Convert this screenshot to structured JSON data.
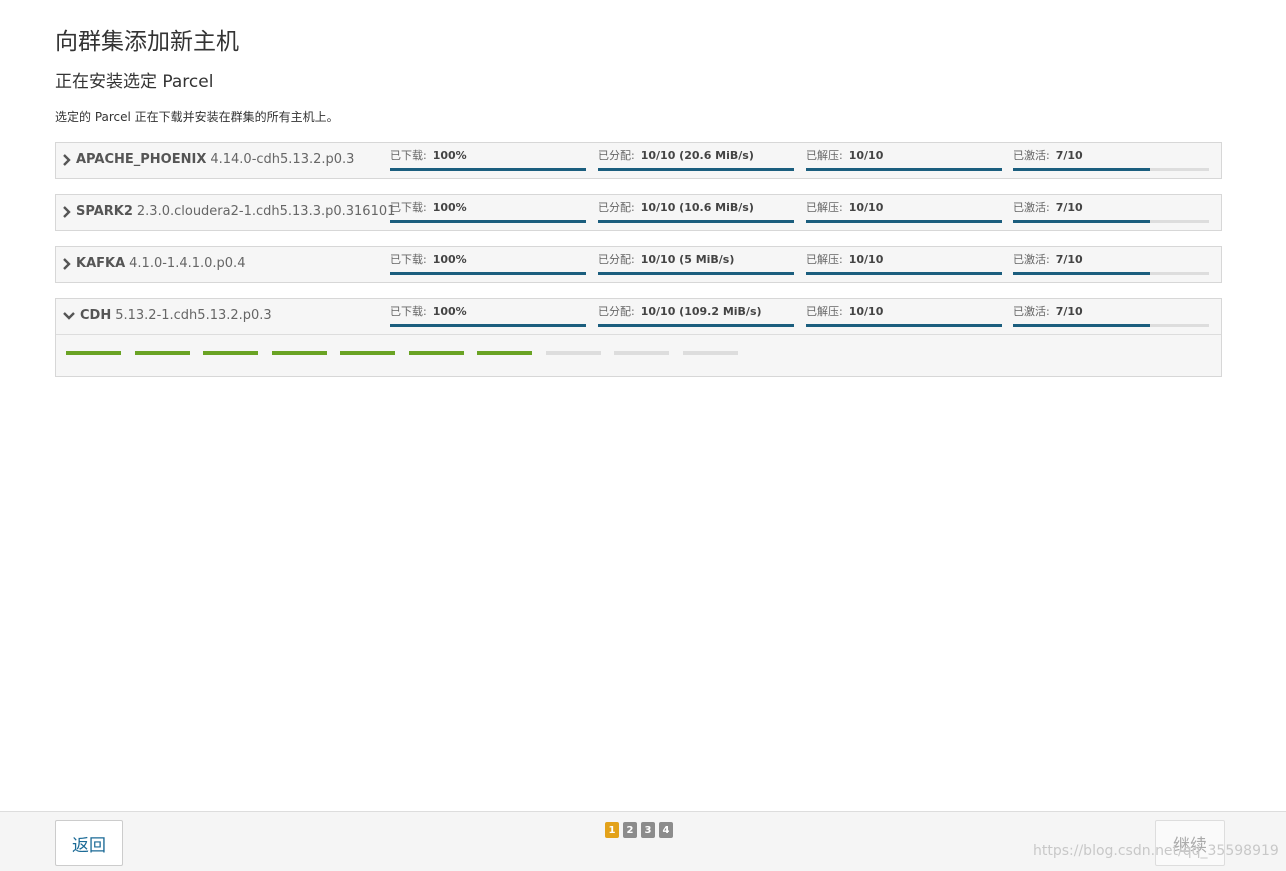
{
  "page_title": "向群集添加新主机",
  "section_title": "正在安装选定 Parcel",
  "description": "选定的 Parcel 正在下载并安装在群集的所有主机上。",
  "parcels": [
    {
      "name": "APACHE_PHOENIX",
      "version": "4.14.0-cdh5.13.2.p0.3",
      "expanded": false,
      "stages": [
        {
          "label": "已下载:",
          "value": "100%",
          "progress": 1.0
        },
        {
          "label": "已分配:",
          "value": "10/10 (20.6 MiB/s)",
          "progress": 1.0
        },
        {
          "label": "已解压:",
          "value": "10/10",
          "progress": 1.0
        },
        {
          "label": "已激活:",
          "value": "7/10",
          "progress": 0.7
        }
      ]
    },
    {
      "name": "SPARK2",
      "version": "2.3.0.cloudera2-1.cdh5.13.3.p0.316101",
      "expanded": false,
      "stages": [
        {
          "label": "已下载:",
          "value": "100%",
          "progress": 1.0
        },
        {
          "label": "已分配:",
          "value": "10/10 (10.6 MiB/s)",
          "progress": 1.0
        },
        {
          "label": "已解压:",
          "value": "10/10",
          "progress": 1.0
        },
        {
          "label": "已激活:",
          "value": "7/10",
          "progress": 0.7
        }
      ]
    },
    {
      "name": "KAFKA",
      "version": "4.1.0-1.4.1.0.p0.4",
      "expanded": false,
      "stages": [
        {
          "label": "已下载:",
          "value": "100%",
          "progress": 1.0
        },
        {
          "label": "已分配:",
          "value": "10/10 (5 MiB/s)",
          "progress": 1.0
        },
        {
          "label": "已解压:",
          "value": "10/10",
          "progress": 1.0
        },
        {
          "label": "已激活:",
          "value": "7/10",
          "progress": 0.7
        }
      ]
    },
    {
      "name": "CDH",
      "version": "5.13.2-1.cdh5.13.2.p0.3",
      "expanded": true,
      "stages": [
        {
          "label": "已下载:",
          "value": "100%",
          "progress": 1.0
        },
        {
          "label": "已分配:",
          "value": "10/10 (109.2 MiB/s)",
          "progress": 1.0
        },
        {
          "label": "已解压:",
          "value": "10/10",
          "progress": 1.0
        },
        {
          "label": "已激活:",
          "value": "7/10",
          "progress": 0.7
        }
      ],
      "hosts_done": 7,
      "hosts_total": 10
    }
  ],
  "footer": {
    "back_label": "返回",
    "continue_label": "继续",
    "steps": [
      "1",
      "2",
      "3",
      "4"
    ],
    "active_step": 0
  },
  "colors": {
    "progress_bar": "#1b5e7e",
    "host_done": "#6aa324",
    "host_pending": "#dddddd",
    "active_step": "#e3a21a"
  },
  "watermark": "https://blog.csdn.net/qq_35598919"
}
